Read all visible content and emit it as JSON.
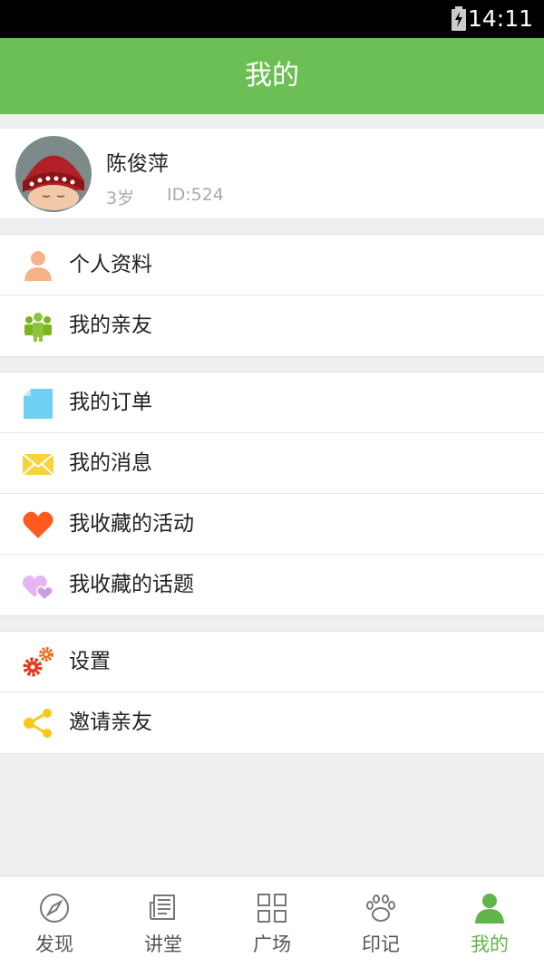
{
  "status_bar": {
    "time": "14:11"
  },
  "header": {
    "title": "我的"
  },
  "profile": {
    "name": "陈俊萍",
    "age": "3岁",
    "id": "ID:524"
  },
  "menu_groups": [
    [
      {
        "label": "个人资料",
        "icon": "person-icon"
      },
      {
        "label": "我的亲友",
        "icon": "family-icon"
      }
    ],
    [
      {
        "label": "我的订单",
        "icon": "document-icon"
      },
      {
        "label": "我的消息",
        "icon": "envelope-icon"
      },
      {
        "label": "我收藏的活动",
        "icon": "heart-icon"
      },
      {
        "label": "我收藏的话题",
        "icon": "double-heart-icon"
      }
    ],
    [
      {
        "label": "设置",
        "icon": "gear-icon"
      },
      {
        "label": "邀请亲友",
        "icon": "share-icon"
      }
    ]
  ],
  "tabs": [
    {
      "label": "发现",
      "icon": "compass-icon"
    },
    {
      "label": "讲堂",
      "icon": "newspaper-icon"
    },
    {
      "label": "广场",
      "icon": "grid-icon"
    },
    {
      "label": "印记",
      "icon": "paw-icon"
    },
    {
      "label": "我的",
      "icon": "person-icon",
      "active": true
    }
  ],
  "colors": {
    "brand": "#6cbf55",
    "active_tab": "#5fb548",
    "background": "#efefef"
  }
}
